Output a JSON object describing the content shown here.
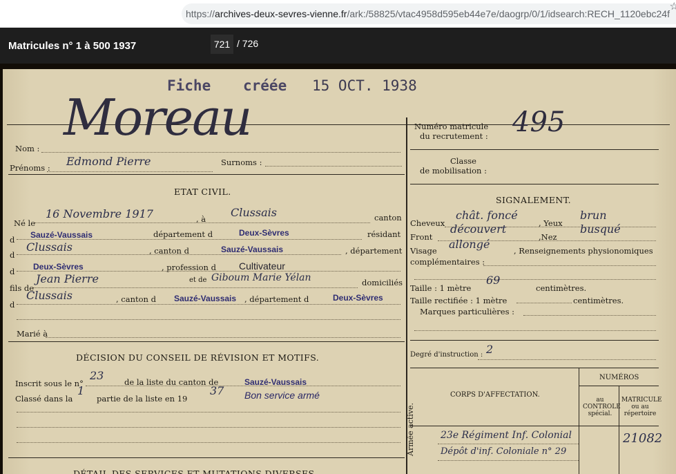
{
  "browser": {
    "url_prefix": "https://",
    "url_host": "archives-deux-sevres-vienne.fr",
    "url_path": "/ark:/58825/vtac4958d595eb44e7e/daogrp/0/1/idsearch:RECH_1120ebc24f"
  },
  "viewer": {
    "title": "Matricules n° 1 à 500 1937",
    "current_page": "721",
    "total_pages": "/ 726"
  },
  "record": {
    "fiche_label": "Fiche",
    "creee_label": "créée",
    "fiche_date": "15 OCT. 1938",
    "name_hand": "Moreau",
    "nom_label": "Nom :",
    "prenoms_label": "Prénoms :",
    "prenoms_hand": "Edmond Pierre",
    "surnoms_label": "Surnoms :",
    "etat_civil": "ETAT CIVIL.",
    "ne_le_label": "Né le",
    "birth_date_hand": "16 Novembre 1917",
    "a_label": ", à",
    "birth_place_hand": "Clussais",
    "canton_label": "canton",
    "d_label": "d",
    "canton_birth": "Sauzé-Vaussais",
    "departement_label": "département d",
    "dept_birth": "Deux-Sèvres",
    "resident_label": "résidant",
    "residence_hand": "Clussais",
    "canton_d_label": ", canton d",
    "canton_res": "Sauzé-Vaussais",
    "departement_end_label": ", département",
    "dept_res": "Deux-Sèvres",
    "profession_label": ", profession d",
    "profession": "Cultivateur",
    "fils_label": "fils de",
    "father_hand": "Jean Pierre",
    "et_label": "et de",
    "mother_hand": "Giboum Marie Yélan",
    "domicilies_label": "domiciliés",
    "parents_place_hand": "Clussais",
    "parents_canton": "Sauzé-Vaussais",
    "departement_d_label": ", département d",
    "parents_dept": "Deux-Sèvres",
    "marie_label": "Marié à",
    "decision_title": "DÉCISION DU CONSEIL DE RÉVISION ET MOTIFS.",
    "inscrit_label": "Inscrit sous le n°",
    "inscrit_num_hand": "23",
    "liste_canton_label": "de la liste du canton de",
    "liste_canton": "Sauzé-Vaussais",
    "classe_label": "Classé dans la",
    "partie_hand": "1",
    "partie_label": "partie de la liste en 19",
    "year_hand": "37",
    "decision_stamp": "Bon service armé",
    "detail_title": "DÉTAIL DES SERVICES ET MUTATIONS DIVERSES.",
    "matricule_label_1": "Numéro matricule",
    "matricule_label_2": "du recrutement :",
    "matricule_hand": "495",
    "classe_mob_1": "Classe",
    "classe_mob_2": "de mobilisation :",
    "signalement": "SIGNALEMENT.",
    "cheveux_label": "Cheveux",
    "cheveux_hand": "chât. foncé",
    "yeux_label": ", Yeux",
    "yeux_hand": "brun",
    "front_label": "Front",
    "front_hand": "découvert",
    "nez_label": ",Nez",
    "nez_hand": "busqué",
    "visage_label": "Visage",
    "visage_hand": "allongé",
    "renseignements_label": ", Renseignements physionomiques",
    "complementaires_label": "complémentaires :",
    "taille_label": "Taille : 1 mètre",
    "taille_hand": "69",
    "centimetres_label": "centimètres.",
    "taille_rect_label": "Taille rectifiée : 1 mètre",
    "centimetres_label_2": "centimètres.",
    "marques_label": "Marques particulières :",
    "degre_label": "Degré d'instruction :",
    "degre_hand": "2",
    "numeros_label": "NUMÉROS",
    "corps_label": "CORPS D'AFFECTATION.",
    "au_controle": "au CONTROLE spécial.",
    "matricule_rep": "MATRICULE ou au répertoire",
    "armee_label": "Armée active.",
    "corps_hand_1": "23e Régiment Inf. Colonial",
    "corps_hand_2": "Dépôt d'inf. Coloniale n° 29",
    "rep_num_hand": "21082"
  }
}
